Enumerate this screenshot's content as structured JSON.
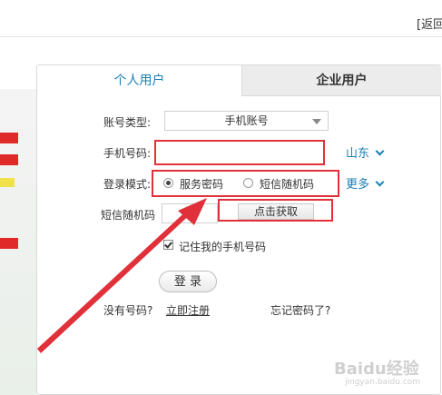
{
  "header": {
    "back_label": "[返回"
  },
  "tabs": {
    "personal": "个人用户",
    "enterprise": "企业用户"
  },
  "form": {
    "account_type_label": "账号类型:",
    "account_type_value": "手机账号",
    "phone_label": "手机号码:",
    "phone_value": "",
    "region": "山东",
    "login_mode_label": "登录模式:",
    "mode_service": "服务密码",
    "mode_sms": "短信随机码",
    "more": "更多",
    "sms_code_label": "短信随机码",
    "get_code_button": "点击获取",
    "remember_label": "记住我的手机号码",
    "login_button": "登 录",
    "no_account": "没有号码?",
    "register": "立即注册",
    "forgot": "忘记密码了?"
  },
  "watermark": {
    "main": "Baidu经验",
    "sub": "jingyan.baidu.com"
  },
  "colors": {
    "accent": "#1a7fb6",
    "highlight": "#e0303a"
  }
}
